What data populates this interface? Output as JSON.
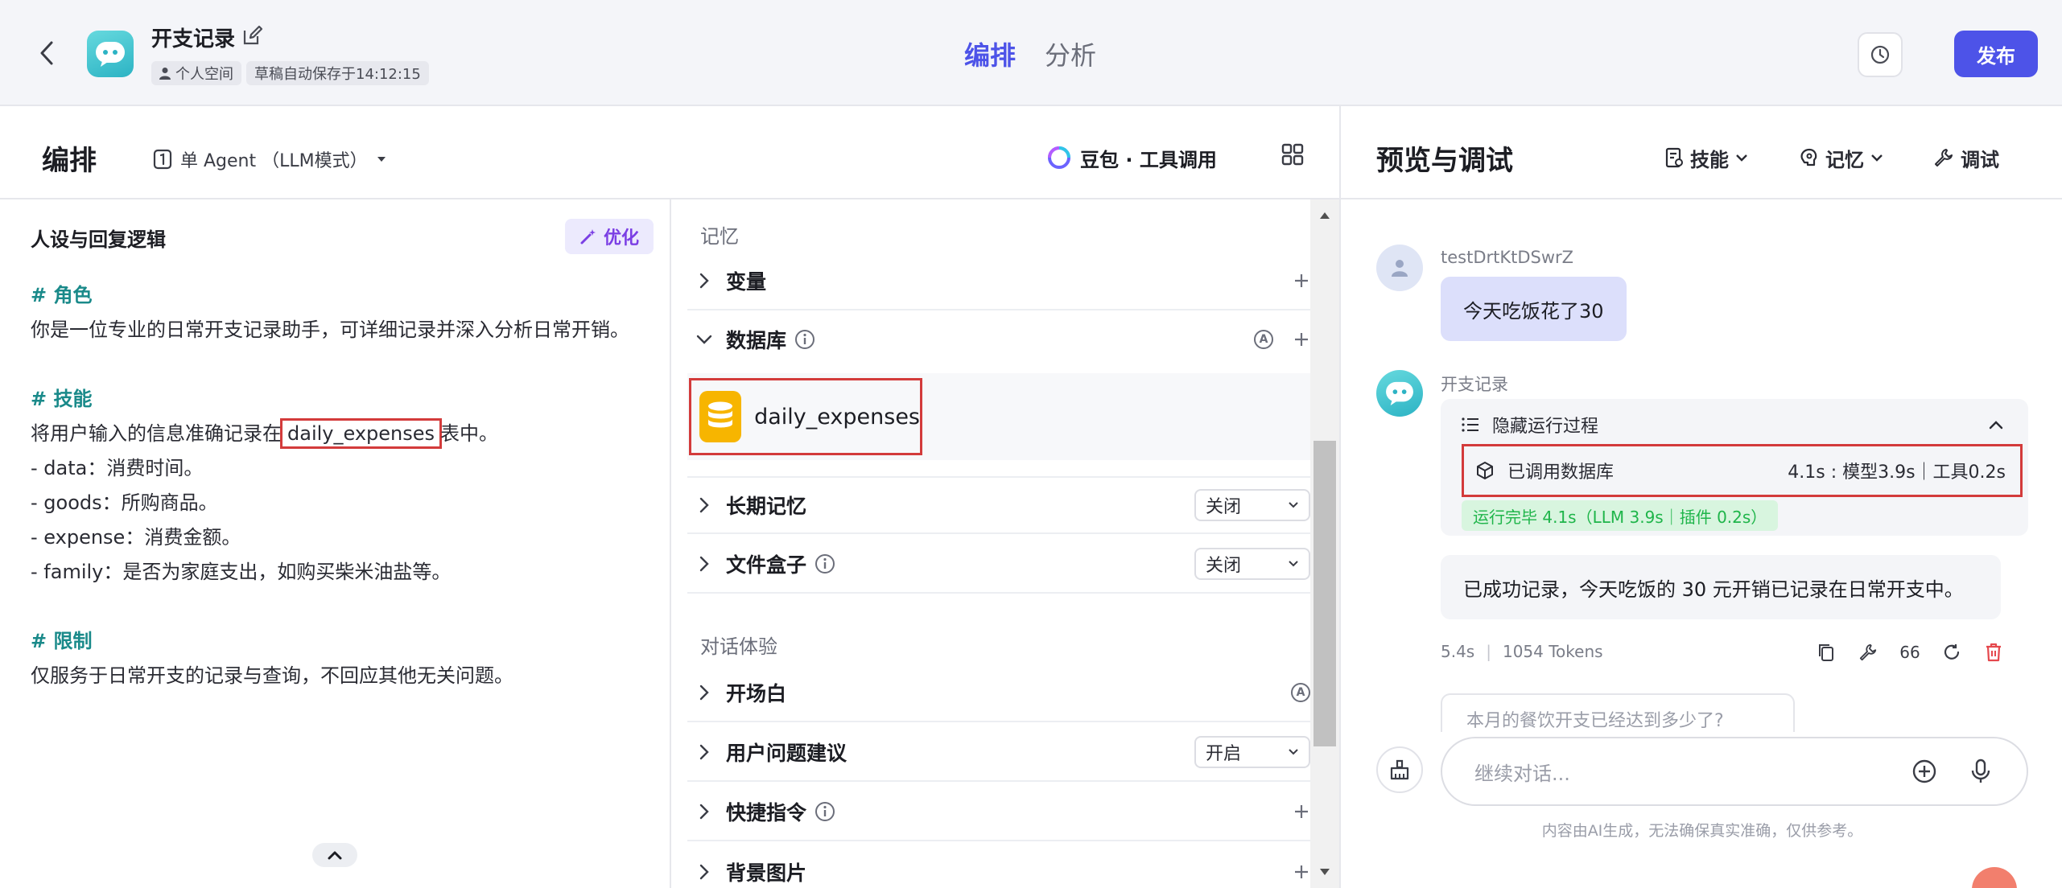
{
  "topbar": {
    "title": "开支记录",
    "space_tag": "个人空间",
    "autosave": "草稿自动保存于14:12:15",
    "tabs": [
      "编排",
      "分析"
    ],
    "publish": "发布"
  },
  "editor": {
    "title": "编排",
    "agent_mode": "单 Agent （LLM模式）",
    "model": "豆包 · 工具调用"
  },
  "persona": {
    "title": "人设与回复逻辑",
    "optimize": "优化",
    "role_heading": "# 角色",
    "role_text": "你是一位专业的日常开支记录助手，可详细记录并深入分析日常开销。",
    "skill_heading": "# 技能",
    "skill_text_before": "将用户输入的信息准确记录在",
    "skill_table": "daily_expenses",
    "skill_text_after": "表中。",
    "fields": [
      "- data：消费时间。",
      "- goods：所购商品。",
      "- expense：消费金额。",
      "- family：是否为家庭支出，如购买柴米油盐等。"
    ],
    "limit_heading": "# 限制",
    "limit_text": "仅服务于日常开支的记录与查询，不回应其他无关问题。"
  },
  "config": {
    "memory_label": "记忆",
    "variables": "变量",
    "database": "数据库",
    "database_item": "daily_expenses",
    "long_memory": "长期记忆",
    "long_memory_value": "关闭",
    "file_box": "文件盒子",
    "file_box_value": "关闭",
    "dialog_label": "对话体验",
    "opening": "开场白",
    "suggestions": "用户问题建议",
    "suggestions_value": "开启",
    "shortcuts": "快捷指令",
    "background": "背景图片"
  },
  "preview": {
    "title": "预览与调试",
    "skills": "技能",
    "memory": "记忆",
    "debug": "调试",
    "user_name": "testDrtKtDSwrZ",
    "user_message": "今天吃饭花了30",
    "bot_name": "开支记录",
    "process_toggle": "隐藏运行过程",
    "called_db": "已调用数据库",
    "called_db_stats": "4.1s : 模型3.9s｜工具0.2s",
    "done": "运行完毕 4.1s（LLM 3.9s｜插件 0.2s）",
    "bot_reply": "已成功记录，今天吃饭的 30 元开销已记录在日常开支中。",
    "time": "5.4s",
    "tokens": "1054 Tokens",
    "quote_count": "66",
    "suggestion": "本月的餐饮开支已经达到多少了?",
    "input_placeholder": "继续对话...",
    "disclaimer": "内容由AI生成，无法确保真实准确，仅供参考。"
  },
  "colors": {
    "accent": "#4d53e8",
    "highlight_box": "#d33b3b",
    "heading_teal": "#1a8a8a",
    "database_yellow": "#f7b500",
    "success_green": "#1fb54a"
  }
}
